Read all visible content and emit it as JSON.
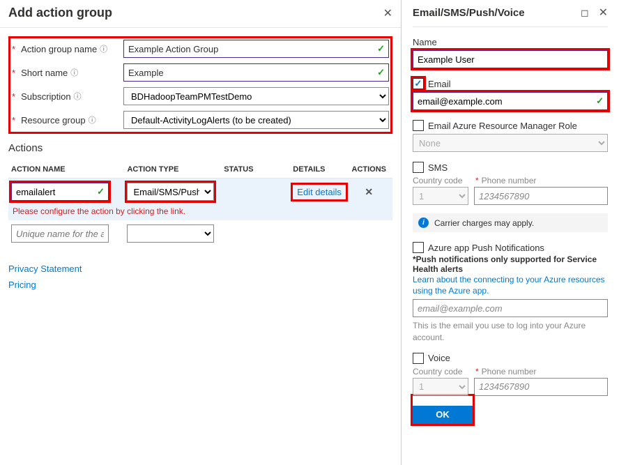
{
  "left": {
    "title": "Add action group",
    "labels": {
      "action_group_name": "Action group name",
      "short_name": "Short name",
      "subscription": "Subscription",
      "resource_group": "Resource group"
    },
    "values": {
      "action_group_name": "Example Action Group",
      "short_name": "Example",
      "subscription": "BDHadoopTeamPMTestDemo",
      "resource_group": "Default-ActivityLogAlerts (to be created)"
    },
    "actions_section": "Actions",
    "cols": {
      "name": "ACTION NAME",
      "type": "ACTION TYPE",
      "status": "STATUS",
      "details": "DETAILS",
      "actions": "ACTIONS"
    },
    "row1": {
      "name": "emailalert",
      "type": "Email/SMS/Push/V...",
      "details_link": "Edit details"
    },
    "row1_error": "Please configure the action by clicking the link.",
    "row2_placeholder": "Unique name for the act...",
    "footer": {
      "privacy": "Privacy Statement",
      "pricing": "Pricing"
    }
  },
  "right": {
    "title": "Email/SMS/Push/Voice",
    "name_label": "Name",
    "name_value": "Example User",
    "email_label": "Email",
    "email_value": "email@example.com",
    "arm_role_label": "Email Azure Resource Manager Role",
    "arm_role_value": "None",
    "sms_label": "SMS",
    "country_code_label": "Country code",
    "phone_label": "Phone number",
    "country_code_value": "1",
    "phone_placeholder": "1234567890",
    "carrier_note": "Carrier charges may apply.",
    "push_label": "Azure app Push Notifications",
    "push_note": "*Push notifications only supported for Service Health alerts",
    "push_link": "Learn about the connecting to your Azure resources using the Azure app.",
    "push_placeholder": "email@example.com",
    "push_hint": "This is the email you use to log into your Azure account.",
    "voice_label": "Voice",
    "ok": "OK"
  }
}
